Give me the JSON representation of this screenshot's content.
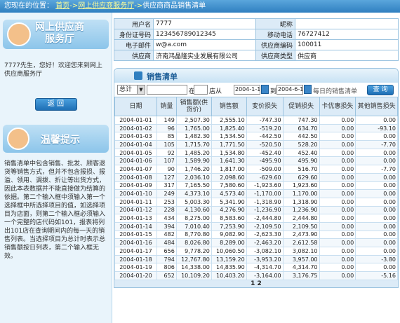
{
  "breadcrumb": {
    "prefix": "您现在的位置：",
    "home": "首页",
    "sep1": "->",
    "section": "网上供应商服务厅",
    "sep2": "->",
    "current": "供应商商品销售清单"
  },
  "sidebar": {
    "title_line1": "网上供应商",
    "title_line2": "服务厅",
    "greeting": "7777先生，您好！欢迎您来到网上供应商服务厅",
    "back_label": "返  回",
    "tips_title": "温馨提示",
    "tips_text": "销售清单中包含销售、批发、顾客退货等销售方式，但并不包含报损、报溢、领用、调拨、折让等出货方式，因此本表数据并不能直接做为结算的依据。第二个输入框中须输入第一个选择框中所选择项目的值，如选择项目为店面，则第二个输入框必须输入一个完整的店代码如101，报表将列出101店在查询期间内的每一天的销售列表。当选择项目为总计时表示总销售额按日列表，第二个输入框无效。"
  },
  "info": {
    "user_label": "用户名",
    "user": "7777",
    "nick_label": "昵称",
    "nick": "",
    "id_label": "身份证号码",
    "id": "123456789012345",
    "mobile_label": "移动电话",
    "mobile": "76727412",
    "email_label": "电子邮件",
    "email": "w@a.com",
    "code_label": "供应商编码",
    "code": "100011",
    "supplier_label": "供应商",
    "supplier": "济南鸿晶隆实业发展有限公司",
    "type_label": "供应商类型",
    "type": "供应商"
  },
  "sales": {
    "title": "销售清单",
    "select_value": "总计",
    "at_label": "在",
    "store_label": "店从",
    "from_date": "2004-1-1 0:",
    "to_label": "到",
    "to_date": "2004-6-1 0:",
    "daily_label": "每日的销售清单",
    "query_label": "查 询",
    "columns": [
      "日期",
      "销量",
      "销售额(供货价)",
      "销售额",
      "变价损失",
      "促销损失",
      "卡优惠损失",
      "其他销售损失"
    ],
    "rows": [
      [
        "2004-01-01",
        "149",
        "2,507.30",
        "2,555.10",
        "-747.30",
        "747.30",
        "0.00",
        "0.00"
      ],
      [
        "2004-01-02",
        "96",
        "1,765.00",
        "1,825.40",
        "-519.20",
        "634.70",
        "0.00",
        "-93.10"
      ],
      [
        "2004-01-03",
        "85",
        "1,482.30",
        "1,534.50",
        "-442.50",
        "442.50",
        "0.00",
        "0.00"
      ],
      [
        "2004-01-04",
        "105",
        "1,715.70",
        "1,771.50",
        "-520.50",
        "528.20",
        "0.00",
        "-7.70"
      ],
      [
        "2004-01-05",
        "92",
        "1,485.20",
        "1,534.80",
        "-452.40",
        "452.40",
        "0.00",
        "0.00"
      ],
      [
        "2004-01-06",
        "107",
        "1,589.90",
        "1,641.30",
        "-495.90",
        "495.90",
        "0.00",
        "0.00"
      ],
      [
        "2004-01-07",
        "90",
        "1,746.20",
        "1,817.00",
        "-509.00",
        "516.70",
        "0.00",
        "-7.70"
      ],
      [
        "2004-01-08",
        "127",
        "2,036.10",
        "2,098.60",
        "-629.60",
        "629.60",
        "0.00",
        "0.00"
      ],
      [
        "2004-01-09",
        "317",
        "7,165.50",
        "7,580.60",
        "-1,923.60",
        "1,923.60",
        "0.00",
        "0.00"
      ],
      [
        "2004-01-10",
        "249",
        "4,373.10",
        "4,573.40",
        "-1,170.00",
        "1,170.00",
        "0.00",
        "0.00"
      ],
      [
        "2004-01-11",
        "253",
        "5,003.30",
        "5,341.90",
        "-1,318.90",
        "1,318.90",
        "0.00",
        "0.00"
      ],
      [
        "2004-01-12",
        "228",
        "4,130.60",
        "4,276.90",
        "-1,236.90",
        "1,236.90",
        "0.00",
        "0.00"
      ],
      [
        "2004-01-13",
        "434",
        "8,275.00",
        "8,583.60",
        "-2,444.80",
        "2,444.80",
        "0.00",
        "0.00"
      ],
      [
        "2004-01-14",
        "394",
        "7,010.40",
        "7,253.90",
        "-2,109.50",
        "2,109.50",
        "0.00",
        "0.00"
      ],
      [
        "2004-01-15",
        "482",
        "8,770.80",
        "9,082.90",
        "-2,623.30",
        "2,473.90",
        "0.00",
        "0.00"
      ],
      [
        "2004-01-16",
        "484",
        "8,026.80",
        "8,289.00",
        "-2,463.20",
        "2,612.58",
        "0.00",
        "0.00"
      ],
      [
        "2004-01-17",
        "656",
        "9,778.20",
        "10,060.50",
        "-3,082.10",
        "3,082.10",
        "0.00",
        "0.00"
      ],
      [
        "2004-01-18",
        "794",
        "12,767.80",
        "13,159.20",
        "-3,953.20",
        "3,957.00",
        "0.00",
        "-3.80"
      ],
      [
        "2004-01-19",
        "806",
        "14,338.00",
        "14,835.90",
        "-4,314.70",
        "4,314.70",
        "0.00",
        "0.00"
      ],
      [
        "2004-01-20",
        "652",
        "10,109.20",
        "10,403.20",
        "-3,164.00",
        "3,176.75",
        "0.00",
        "-5.16"
      ]
    ],
    "pager": "1 2"
  }
}
